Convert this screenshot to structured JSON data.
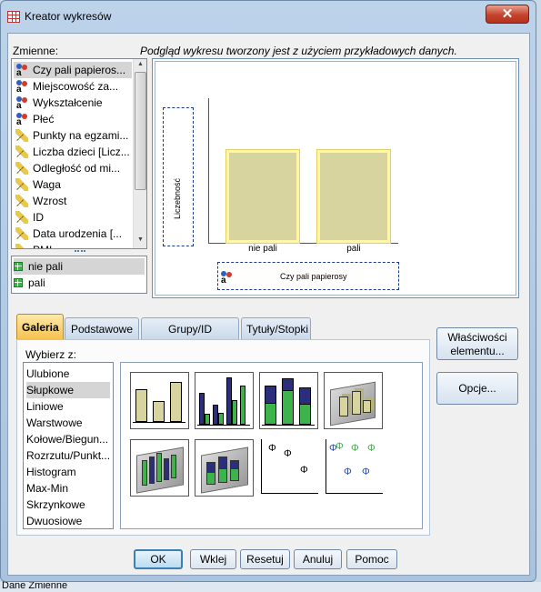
{
  "window": {
    "title": "Kreator wykresów",
    "close_symbol": "✕"
  },
  "variables": {
    "label": "Zmienne:",
    "items": [
      {
        "label": "Czy pali papieros...",
        "icon": "nominal-icon"
      },
      {
        "label": "Miejscowość za...",
        "icon": "nominal-icon"
      },
      {
        "label": "Wykształcenie",
        "icon": "nominal-icon"
      },
      {
        "label": "Płeć",
        "icon": "nominal-icon"
      },
      {
        "label": "Punkty na egzami...",
        "icon": "scale-icon"
      },
      {
        "label": "Liczba dzieci [Licz...",
        "icon": "scale-icon"
      },
      {
        "label": "Odległość od mi...",
        "icon": "scale-icon"
      },
      {
        "label": "Waga",
        "icon": "scale-icon"
      },
      {
        "label": "Wzrost",
        "icon": "scale-icon"
      },
      {
        "label": "ID",
        "icon": "scale-icon"
      },
      {
        "label": "Data urodzenia [...",
        "icon": "scale-icon"
      },
      {
        "label": "PMI",
        "icon": "scale-icon"
      }
    ]
  },
  "categories": {
    "items": [
      "nie pali",
      "pali"
    ]
  },
  "preview": {
    "caption": "Podgląd wykresu tworzony jest z użyciem przykładowych danych.",
    "y_label": "Liczebność",
    "x_var": "Czy pali papierosy",
    "bars": [
      {
        "label": "nie pali",
        "value": 1
      },
      {
        "label": "pali",
        "value": 1
      }
    ]
  },
  "tabs": [
    {
      "label": "Galeria",
      "active": true
    },
    {
      "label": "Podstawowe",
      "active": false
    },
    {
      "label": "Grupy/ID punktów",
      "active": false
    },
    {
      "label": "Tytuły/Stopki",
      "active": false
    }
  ],
  "gallery": {
    "choose_label": "Wybierz z:",
    "types": [
      "Ulubione",
      "Słupkowe",
      "Liniowe",
      "Warstwowe",
      "Kołowe/Biegun...",
      "Rozrzutu/Punkt...",
      "Histogram",
      "Max-Min",
      "Skrzynkowe",
      "Dwuosiowe"
    ],
    "selected": "Słupkowe",
    "colors": {
      "bar_beige": "#d8d4a0",
      "navy": "#2b2e7a",
      "green": "#3cb44b"
    }
  },
  "side_buttons": {
    "properties": "Właściwości elementu...",
    "options": "Opcje..."
  },
  "buttons": {
    "ok": "OK",
    "paste": "Wklej",
    "reset": "Resetuj",
    "cancel": "Anuluj",
    "help": "Pomoc"
  },
  "background_text": "Dane  Zmienne"
}
